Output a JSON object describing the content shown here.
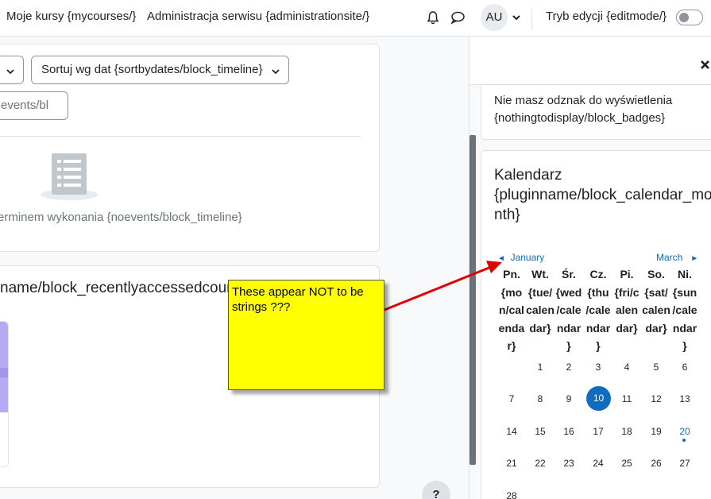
{
  "navbar": {
    "my_courses": "Moje kursy {mycourses/}",
    "site_admin": "Administracja serwisu {administrationsite/}",
    "user_initials": "AU",
    "edit_mode_label": "Tryb edycji {editmode/}"
  },
  "timeline": {
    "sort_label": "Sortuj wg dat {sortbydates/block_timeline}",
    "search_placeholder": "events/bl",
    "empty_message": "erminem wykonania {noevents/block_timeline}"
  },
  "recent_courses": {
    "title": "name/block_recentlyaccessedcourses}"
  },
  "drawer": {
    "badges_empty": "Nie masz odznak do wyświetlenia {nothingtodisplay/block_badges}",
    "calendar": {
      "title_line1": "Kalendarz",
      "title_line2": "{pluginname/block_calendar_mo",
      "title_line3": "nth}",
      "prev_month": "January",
      "next_month": "March",
      "day_headers": [
        [
          "Pn.",
          "{mo",
          "n/cal",
          "enda",
          "r}"
        ],
        [
          "Wt.",
          "{tue/",
          "calen",
          "dar}"
        ],
        [
          "Śr.",
          "{wed",
          "/cale",
          "ndar",
          "}"
        ],
        [
          "Cz.",
          "{thu",
          "/cale",
          "ndar",
          "}"
        ],
        [
          "Pi.",
          "{fri/c",
          "alen",
          "dar}"
        ],
        [
          "So.",
          "{sat/",
          "calen",
          "dar}"
        ],
        [
          "Ni.",
          "{sun",
          "/cale",
          "ndar",
          "}"
        ]
      ],
      "weeks": [
        [
          "",
          "1",
          "2",
          "3",
          "4",
          "5",
          "6"
        ],
        [
          "7",
          "8",
          "9",
          "10",
          "11",
          "12",
          "13"
        ],
        [
          "14",
          "15",
          "16",
          "17",
          "18",
          "19",
          "20"
        ],
        [
          "21",
          "22",
          "23",
          "24",
          "25",
          "26",
          "27"
        ],
        [
          "28",
          "",
          "",
          "",
          "",
          "",
          ""
        ]
      ],
      "today": "10",
      "event_day": "20"
    }
  },
  "annotation": {
    "note_text": "These appear NOT to be strings ???"
  },
  "help": {
    "label": "?"
  },
  "colors": {
    "accent": "#0f6cbf",
    "note_bg": "#ffff00",
    "arrow": "#e00000"
  }
}
